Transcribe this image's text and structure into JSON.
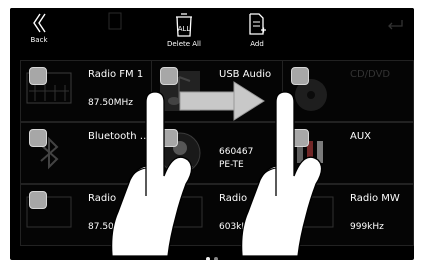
{
  "toolbar": {
    "back_label": "Back",
    "delete_all_label": "Delete All",
    "add_label": "Add",
    "delete_all_icon_text": "ALL"
  },
  "tiles": [
    {
      "name": "Radio FM 1",
      "sub": "87.50MHz",
      "icon": "radio-icon"
    },
    {
      "name": "USB Audio",
      "sub": "",
      "icon": "music-note-icon"
    },
    {
      "name": "CD/DVD",
      "sub": "",
      "icon": "disc-icon"
    },
    {
      "name": "Bluetooth …",
      "sub": "",
      "icon": "bluetooth-icon"
    },
    {
      "name": "",
      "sub": "660467",
      "sub2": "PE-TE",
      "icon": "contact-icon"
    },
    {
      "name": "AUX",
      "sub": "",
      "icon": "aux-plugs-icon"
    },
    {
      "name": "Radio",
      "sub": "87.50MI",
      "icon": "radio-icon"
    },
    {
      "name": "Radio",
      "sub": "603kHz",
      "icon": "radio-icon"
    },
    {
      "name": "Radio MW",
      "sub": "999kHz",
      "icon": "radio-icon"
    }
  ],
  "pager": {
    "pages": 2,
    "current": 1
  },
  "colors": {
    "background": "#000000",
    "checkbox": "#a7a7a7",
    "arrow": "#c8c8c8"
  }
}
